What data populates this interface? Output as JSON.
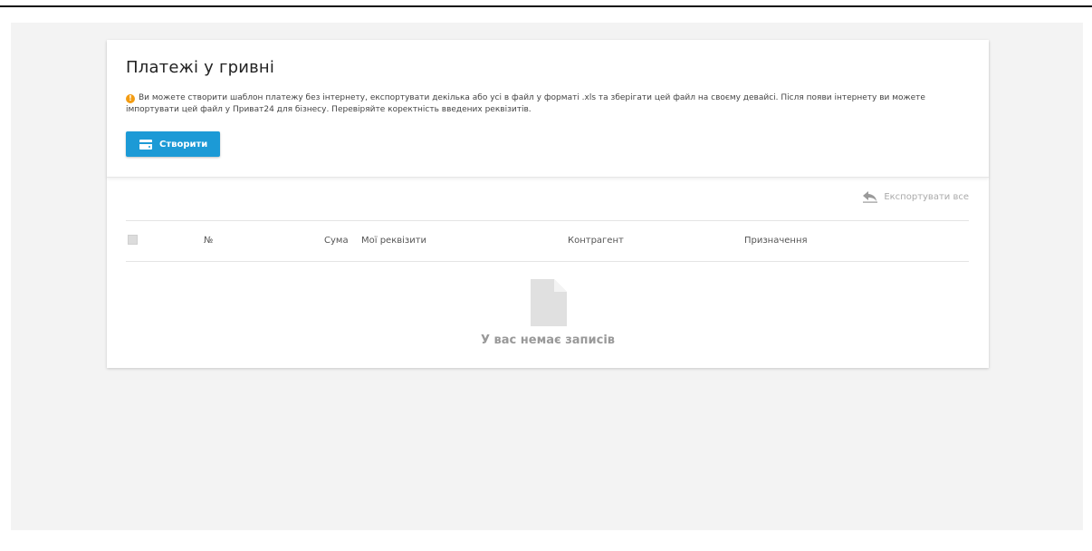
{
  "header": {
    "title": "Платежі у гривні",
    "info_text": "Ви можете створити шаблон платежу без інтернету, експортувати декілька або усі в файл у форматі .xls та зберігати цей файл на своєму девайсі. Після появи інтернету ви можете імпортувати цей файл у Приват24 для бізнесу. Перевіряйте коректність введених реквізитів.",
    "create_label": "Створити"
  },
  "toolbar": {
    "export_all_label": "Експортувати все"
  },
  "table": {
    "columns": [
      "№",
      "Сума",
      "Мої реквізити",
      "Контрагент",
      "Призначення"
    ],
    "rows": []
  },
  "empty_state": {
    "text": "У вас немає записів"
  },
  "colors": {
    "accent": "#1c9ad6",
    "info_icon": "#f39c12",
    "background": "#f3f3f3"
  }
}
